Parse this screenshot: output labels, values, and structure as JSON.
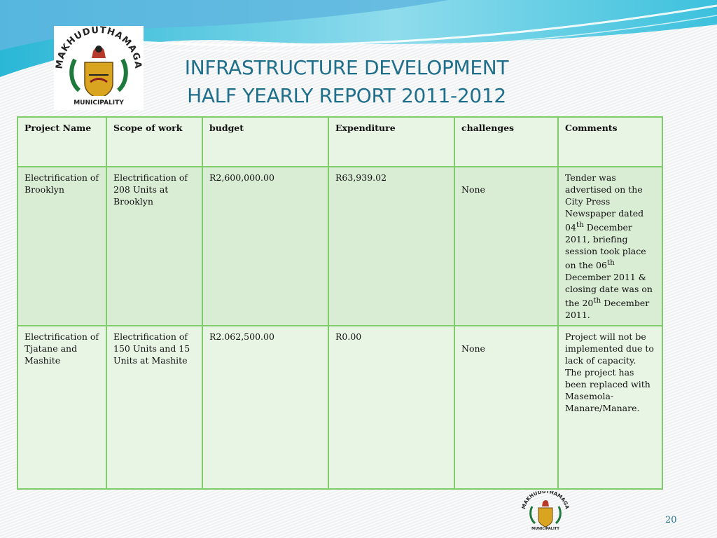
{
  "title": {
    "line1": "INFRASTRUCTURE DEVELOPMENT",
    "line2": "HALF YEARLY REPORT 2011-2012"
  },
  "logo": {
    "arc_text": "MAKHUDUTHAMAGA",
    "banner_text": "MUNICIPALITY"
  },
  "table": {
    "headers": [
      "Project Name",
      "Scope of work",
      "budget",
      "Expenditure",
      "challenges",
      "Comments"
    ],
    "rows": [
      {
        "project_name": "Electrification of Brooklyn",
        "scope": "Electrification of 208 Units at Brooklyn",
        "budget": "R2,600,000.00",
        "expenditure": "R63,939.02",
        "challenges": "None",
        "comments": {
          "p1": "Tender was advertised on the City Press Newspaper dated 04",
          "s1": "th",
          "p2": " December 2011, briefing session took place  on the 06",
          "s2": "th",
          "p3": " December 2011 & closing date was on the 20",
          "s3": "th",
          "p4": " December 2011."
        }
      },
      {
        "project_name": "Electrification of Tjatane and Mashite",
        "scope": "Electrification of 150 Units and 15 Units at Mashite",
        "budget": "R2.062,500.00",
        "expenditure": "R0.00",
        "challenges": "None",
        "comments": "Project will not be implemented due to lack of capacity. The project has been replaced with Masemola-Manare/Manare."
      }
    ]
  },
  "page_number": "20",
  "colors": {
    "title": "#1f6f8b",
    "table_border": "#7fcc6b",
    "row_fill_dark": "#d9ecd4",
    "row_fill_light": "#e8f4e4"
  }
}
